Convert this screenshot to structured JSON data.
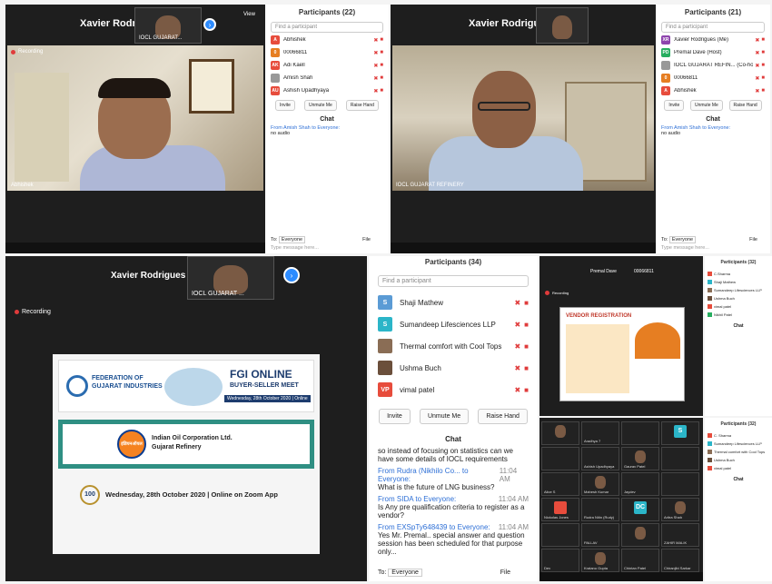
{
  "q1": {
    "speaker_name": "Xavier Rodrigues",
    "thumb_label": "IOCL GUJARAT...",
    "view_label": "View",
    "recording": "Recording",
    "video_label": "Abhishek",
    "participants_title": "Participants (22)",
    "find_placeholder": "Find a participant",
    "participants": [
      {
        "initial": "A",
        "color": "#e74c3c",
        "name": "Abhishek"
      },
      {
        "initial": "0",
        "color": "#e67e22",
        "name": "00066811"
      },
      {
        "initial": "AK",
        "color": "#e74c3c",
        "name": "Adi Kaell"
      },
      {
        "initial": "",
        "color": "#999999",
        "name": "Amish Shah"
      },
      {
        "initial": "AU",
        "color": "#e74c3c",
        "name": "Ashish Upadhyaya"
      }
    ],
    "buttons": [
      "Invite",
      "Unmute Me",
      "Raise Hand"
    ],
    "chat_title": "Chat",
    "chat_from": "From Amish Shah to Everyone:",
    "chat_text": "no audio",
    "to_label": "To:",
    "to_value": "Everyone",
    "file_label": "File",
    "type_placeholder": "Type message here..."
  },
  "q2": {
    "speaker_name": "Xavier Rodrigues",
    "video_label": "IOCL GUJARAT REFINERY",
    "participants_title": "Participants (21)",
    "find_placeholder": "Find a participant",
    "participants": [
      {
        "initial": "XR",
        "color": "#8e44ad",
        "name": "Xavier Rodrigues (Me)"
      },
      {
        "initial": "PD",
        "color": "#27ae60",
        "name": "Premal Dave (Host)"
      },
      {
        "initial": "",
        "color": "#999999",
        "name": "IOCL GUJARAT REFIN... (Co-host)"
      },
      {
        "initial": "0",
        "color": "#e67e22",
        "name": "00066811"
      },
      {
        "initial": "A",
        "color": "#e74c3c",
        "name": "Abhishek"
      }
    ],
    "buttons": [
      "Invite",
      "Unmute Me",
      "Raise Hand"
    ],
    "chat_title": "Chat",
    "chat_from": "From Amish Shah to Everyone:",
    "chat_text": "no audio",
    "to_label": "To:",
    "to_value": "Everyone",
    "file_label": "File",
    "type_placeholder": "Type message here..."
  },
  "q3": {
    "speaker_name": "Xavier Rodrigues",
    "thumb_label": "IOCL GUJARAT ...",
    "recording": "Recording",
    "banner": {
      "fgi_name_line1": "FEDERATION OF",
      "fgi_name_line2": "GUJARAT INDUSTRIES",
      "fgi_short": "FGI",
      "event_title_line1": "FGI ONLINE",
      "event_title_line2": "BUYER-SELLER MEET",
      "event_date_chip": "Wednesday, 28th October 2020 | Online",
      "company_hindi": "इंडियनऑयल",
      "company_line1": "Indian Oil Corporation Ltd.",
      "company_line2": "Gujarat Refinery",
      "footer_badge": "100",
      "footer_text": "Wednesday, 28th October 2020 | Online on Zoom App"
    }
  },
  "q4": {
    "participants_title": "Participants (34)",
    "find_placeholder": "Find a participant",
    "participants": [
      {
        "initial": "S",
        "color": "#5b9bd5",
        "name": "Shaji Mathew"
      },
      {
        "initial": "S",
        "color": "#2bb5c8",
        "name": "Sumandeep Lifesciences LLP"
      },
      {
        "initial": "",
        "color": "#8a6d55",
        "name": "Thermal comfort with Cool Tops"
      },
      {
        "initial": "",
        "color": "#6b4f3b",
        "name": "Ushma Buch"
      },
      {
        "initial": "VP",
        "color": "#e74c3c",
        "name": "vimal patel"
      }
    ],
    "buttons": [
      "Invite",
      "Unmute Me",
      "Raise Hand"
    ],
    "chat_title": "Chat",
    "chat_msgs": [
      {
        "from": "",
        "text": "so instead of focusing on statistics can we have some details of IOCL requirements",
        "time": ""
      },
      {
        "from": "From Rudra (Nikhilo Co... to Everyone:",
        "text": "What is the  future of LNG business?",
        "time": "11:04 AM"
      },
      {
        "from": "From SIDA to Everyone:",
        "text": "Is Any pre qualification criteria to register as a vendor?",
        "time": "11:04 AM"
      },
      {
        "from": "From EXSpTy648439 to Everyone:",
        "text": "Yes Mr. Premal.. special answer and question session has been scheduled for that purpose only...",
        "time": "11:04 AM"
      }
    ],
    "to_label": "To:",
    "to_value": "Everyone",
    "file_label": "File"
  },
  "q5": {
    "top_names": [
      "Premal Dave",
      "00066811"
    ],
    "slide_title": "VENDOR REGISTRATION",
    "recording": "Recording",
    "grid_names": [
      "",
      "Aradhya 7",
      "",
      "S",
      "",
      "Ashish Upadhyaya",
      "Gaurav Patel",
      "",
      "Alice S",
      "Mahesh Kumar",
      "Jaydev",
      "",
      "Nickolas Jones",
      "Rudra Nitin (Rudy)",
      "DC",
      "Aritra Shah",
      "",
      "PALLAV",
      "",
      "ZAHIR MALIK",
      "Dev",
      "Kratanu Gupta",
      "Chintan Patel",
      "Chiranjibi Sarkar"
    ],
    "right_title": "Participants (32)",
    "right_participants": [
      "C.Sharma",
      "Shaji Mathew",
      "Sumandeep Lifesciences LLP",
      "Ushma Buch",
      "vimal patel",
      "Nikhil Patel"
    ],
    "right_title2": "Participants (32)",
    "right_participants2": [
      "C. Sharma",
      "Sumandeep Lifesciences LLP",
      "Thermal comfort with Cool Tops",
      "Ushma Buch",
      "vimal patel"
    ],
    "chat_title": "Chat"
  }
}
